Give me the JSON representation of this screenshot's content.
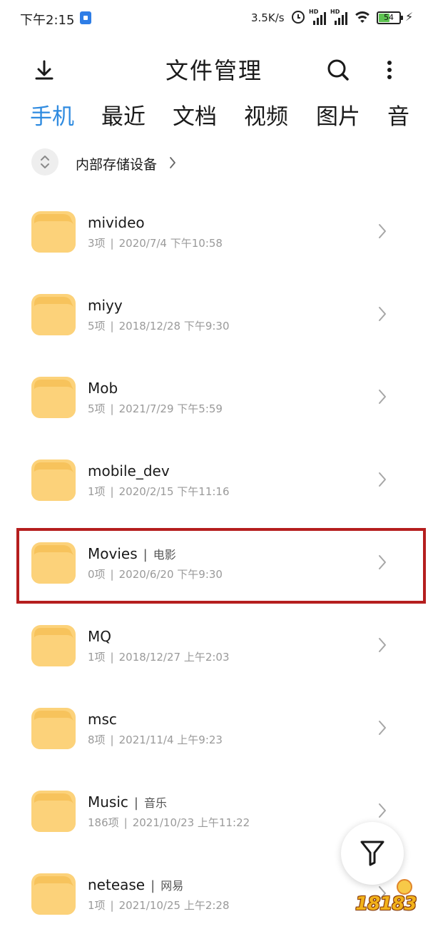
{
  "status_bar": {
    "time": "下午2:15",
    "net_speed": "3.5K/s",
    "battery_level": "54",
    "battery_fraction": 0.54,
    "icons": [
      "notification-app-icon",
      "alarm-icon",
      "signal-hd-icon",
      "signal-hd-icon",
      "wifi-icon",
      "battery-icon",
      "charging-icon"
    ],
    "signal_hd_label": "HD",
    "charge_glyph": "⚡"
  },
  "app_bar": {
    "title": "文件管理",
    "icons": [
      "download-icon",
      "search-icon",
      "more-vertical-icon"
    ]
  },
  "tabs": [
    {
      "label": "手机",
      "active": true
    },
    {
      "label": "最近",
      "active": false
    },
    {
      "label": "文档",
      "active": false
    },
    {
      "label": "视频",
      "active": false
    },
    {
      "label": "图片",
      "active": false
    },
    {
      "label": "音",
      "active": false
    }
  ],
  "breadcrumb": {
    "label": "内部存储设备",
    "icons": [
      "expand-collapse-icon",
      "chevron-right-icon"
    ]
  },
  "files": [
    {
      "name": "mivideo",
      "alias": "",
      "count": "3项",
      "date": "2020/7/4 下午10:58"
    },
    {
      "name": "miyy",
      "alias": "",
      "count": "5项",
      "date": "2018/12/28 下午9:30"
    },
    {
      "name": "Mob",
      "alias": "",
      "count": "5项",
      "date": "2021/7/29 下午5:59"
    },
    {
      "name": "mobile_dev",
      "alias": "",
      "count": "1项",
      "date": "2020/2/15 下午11:16"
    },
    {
      "name": "Movies",
      "alias": "电影",
      "count": "0项",
      "date": "2020/6/20 下午9:30",
      "highlighted": true
    },
    {
      "name": "MQ",
      "alias": "",
      "count": "1项",
      "date": "2018/12/27 上午2:03"
    },
    {
      "name": "msc",
      "alias": "",
      "count": "8项",
      "date": "2021/11/4 上午9:23"
    },
    {
      "name": "Music",
      "alias": "音乐",
      "count": "186项",
      "date": "2021/10/23 上午11:22"
    },
    {
      "name": "netease",
      "alias": "网易",
      "count": "1项",
      "date": "2021/10/25 上午2:28"
    }
  ],
  "separator": "|",
  "fab": {
    "icon": "filter-icon"
  },
  "watermark": {
    "text": "18183"
  },
  "colors": {
    "accent": "#2f8be0",
    "folder": "#fcd27a",
    "folder_tab": "#f7c35c",
    "highlight": "#b51e1e",
    "secondary_text": "#9a9a9a"
  }
}
